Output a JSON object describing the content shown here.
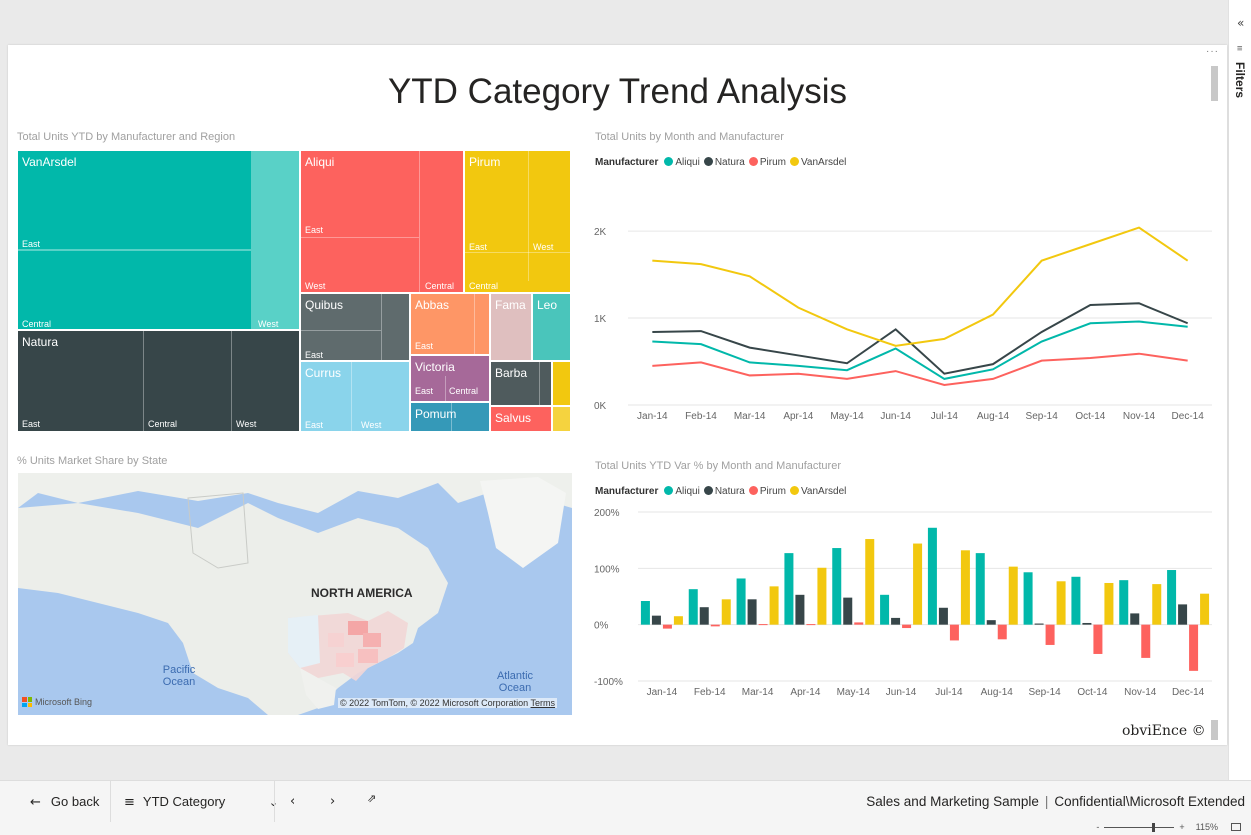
{
  "report": {
    "title": "YTD Category Trend Analysis",
    "watermark": "obviEnce ©"
  },
  "filters_pane": {
    "collapse_icon": "«",
    "filter_icon": "filter-icon",
    "label": "Filters"
  },
  "visuals": {
    "treemap": {
      "title": "Total Units YTD by Manufacturer and Region",
      "cells": [
        {
          "name": "VanArsdel",
          "color": "#01B8AA",
          "subs": [
            "East",
            "Central",
            "West"
          ]
        },
        {
          "name": "Natura",
          "color": "#374649",
          "subs": [
            "East",
            "Central",
            "West"
          ]
        },
        {
          "name": "Aliqui",
          "color": "#FD625E",
          "subs": [
            "East",
            "West",
            "Central"
          ]
        },
        {
          "name": "Pirum",
          "color": "#F2C80F",
          "subs": [
            "East",
            "West",
            "Central"
          ]
        },
        {
          "name": "Quibus",
          "color": "#5F6B6D",
          "subs": [
            "East"
          ]
        },
        {
          "name": "Abbas",
          "color": "#FE9666",
          "subs": [
            "East"
          ]
        },
        {
          "name": "Fama",
          "color": "#DFBFBF",
          "subs": []
        },
        {
          "name": "Leo",
          "color": "#4AC5BB",
          "subs": []
        },
        {
          "name": "Currus",
          "color": "#8AD4EB",
          "subs": [
            "East",
            "West"
          ]
        },
        {
          "name": "Victoria",
          "color": "#A66999",
          "subs": [
            "East",
            "Central"
          ]
        },
        {
          "name": "Barba",
          "color": "#4F5B5D",
          "subs": []
        },
        {
          "name": "Pomum",
          "color": "#3599B8",
          "subs": []
        },
        {
          "name": "Salvus",
          "color": "#FD625E",
          "subs": []
        }
      ]
    },
    "map": {
      "title": "% Units Market Share by State",
      "labels": {
        "continent": "NORTH AMERICA",
        "pacific": "Pacific\nOcean",
        "atlantic": "Atlantic\nOcean"
      },
      "bing": "Microsoft Bing",
      "attribution": "© 2022 TomTom, © 2022 Microsoft Corporation",
      "terms": "Terms"
    }
  },
  "chart_data": [
    {
      "type": "line",
      "title": "Total Units by Month and Manufacturer",
      "legend_title": "Manufacturer",
      "legend_position": "top-left",
      "x": [
        "Jan-14",
        "Feb-14",
        "Mar-14",
        "Apr-14",
        "May-14",
        "Jun-14",
        "Jul-14",
        "Aug-14",
        "Sep-14",
        "Oct-14",
        "Nov-14",
        "Dec-14"
      ],
      "y_ticks": [
        "0K",
        "1K",
        "2K"
      ],
      "ylim": [
        0,
        2300
      ],
      "grid": true,
      "series": [
        {
          "name": "Aliqui",
          "color": "#01B8AA",
          "values": [
            730,
            700,
            490,
            450,
            400,
            650,
            300,
            410,
            730,
            940,
            960,
            900
          ]
        },
        {
          "name": "Natura",
          "color": "#374649",
          "values": [
            840,
            850,
            660,
            570,
            480,
            870,
            360,
            470,
            840,
            1150,
            1170,
            940
          ]
        },
        {
          "name": "Pirum",
          "color": "#FD625E",
          "values": [
            450,
            490,
            340,
            360,
            300,
            390,
            230,
            300,
            510,
            540,
            590,
            510
          ]
        },
        {
          "name": "VanArsdel",
          "color": "#F2C80F",
          "values": [
            1660,
            1620,
            1480,
            1120,
            870,
            680,
            760,
            1040,
            1660,
            1850,
            2040,
            1660
          ]
        }
      ]
    },
    {
      "type": "bar",
      "title": "Total Units YTD Var % by Month and Manufacturer",
      "legend_title": "Manufacturer",
      "legend_position": "top-left",
      "categories": [
        "Jan-14",
        "Feb-14",
        "Mar-14",
        "Apr-14",
        "May-14",
        "Jun-14",
        "Jul-14",
        "Aug-14",
        "Sep-14",
        "Oct-14",
        "Nov-14",
        "Dec-14"
      ],
      "y_ticks": [
        "-100%",
        "0%",
        "100%",
        "200%"
      ],
      "ylim": [
        -100,
        200
      ],
      "grid": true,
      "series": [
        {
          "name": "Aliqui",
          "color": "#01B8AA",
          "values": [
            42,
            63,
            82,
            127,
            136,
            53,
            172,
            127,
            93,
            85,
            79,
            97
          ]
        },
        {
          "name": "Natura",
          "color": "#374649",
          "values": [
            16,
            31,
            45,
            53,
            48,
            12,
            30,
            8,
            2,
            3,
            20,
            36
          ]
        },
        {
          "name": "Pirum",
          "color": "#FD625E",
          "values": [
            -7,
            -3,
            1,
            1,
            4,
            -6,
            -28,
            -26,
            -36,
            -52,
            -59,
            -82
          ]
        },
        {
          "name": "VanArsdel",
          "color": "#F2C80F",
          "values": [
            15,
            45,
            68,
            101,
            152,
            144,
            132,
            103,
            77,
            74,
            72,
            55
          ]
        }
      ]
    }
  ],
  "bottom_bar": {
    "go_back": "Go back",
    "page_name": "YTD Category",
    "breadcrumb_report": "Sales and Marketing Sample",
    "breadcrumb_sep": "|",
    "breadcrumb_label": "Confidential\\Microsoft Extended"
  },
  "status_bar": {
    "zoom_minus": "-",
    "zoom_plus": "+",
    "zoom_level": "115%"
  }
}
